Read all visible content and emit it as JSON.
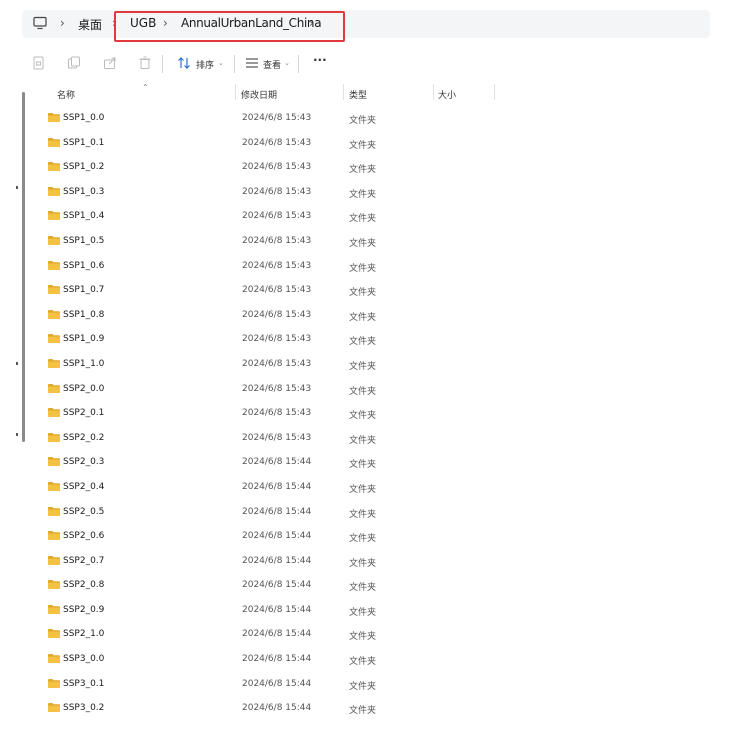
{
  "breadcrumb": {
    "items": [
      "桌面",
      "UGB",
      "AnnualUrbanLand_China"
    ]
  },
  "toolbar": {
    "sort_label": "排序",
    "view_label": "查看",
    "more_label": "···"
  },
  "columns": {
    "name": "名称",
    "modified": "修改日期",
    "type": "类型",
    "size": "大小"
  },
  "files": [
    {
      "name": "SSP1_0.0",
      "modified": "2024/6/8 15:43",
      "type": "文件夹"
    },
    {
      "name": "SSP1_0.1",
      "modified": "2024/6/8 15:43",
      "type": "文件夹"
    },
    {
      "name": "SSP1_0.2",
      "modified": "2024/6/8 15:43",
      "type": "文件夹"
    },
    {
      "name": "SSP1_0.3",
      "modified": "2024/6/8 15:43",
      "type": "文件夹"
    },
    {
      "name": "SSP1_0.4",
      "modified": "2024/6/8 15:43",
      "type": "文件夹"
    },
    {
      "name": "SSP1_0.5",
      "modified": "2024/6/8 15:43",
      "type": "文件夹"
    },
    {
      "name": "SSP1_0.6",
      "modified": "2024/6/8 15:43",
      "type": "文件夹"
    },
    {
      "name": "SSP1_0.7",
      "modified": "2024/6/8 15:43",
      "type": "文件夹"
    },
    {
      "name": "SSP1_0.8",
      "modified": "2024/6/8 15:43",
      "type": "文件夹"
    },
    {
      "name": "SSP1_0.9",
      "modified": "2024/6/8 15:43",
      "type": "文件夹"
    },
    {
      "name": "SSP1_1.0",
      "modified": "2024/6/8 15:43",
      "type": "文件夹"
    },
    {
      "name": "SSP2_0.0",
      "modified": "2024/6/8 15:43",
      "type": "文件夹"
    },
    {
      "name": "SSP2_0.1",
      "modified": "2024/6/8 15:43",
      "type": "文件夹"
    },
    {
      "name": "SSP2_0.2",
      "modified": "2024/6/8 15:43",
      "type": "文件夹"
    },
    {
      "name": "SSP2_0.3",
      "modified": "2024/6/8 15:44",
      "type": "文件夹"
    },
    {
      "name": "SSP2_0.4",
      "modified": "2024/6/8 15:44",
      "type": "文件夹"
    },
    {
      "name": "SSP2_0.5",
      "modified": "2024/6/8 15:44",
      "type": "文件夹"
    },
    {
      "name": "SSP2_0.6",
      "modified": "2024/6/8 15:44",
      "type": "文件夹"
    },
    {
      "name": "SSP2_0.7",
      "modified": "2024/6/8 15:44",
      "type": "文件夹"
    },
    {
      "name": "SSP2_0.8",
      "modified": "2024/6/8 15:44",
      "type": "文件夹"
    },
    {
      "name": "SSP2_0.9",
      "modified": "2024/6/8 15:44",
      "type": "文件夹"
    },
    {
      "name": "SSP2_1.0",
      "modified": "2024/6/8 15:44",
      "type": "文件夹"
    },
    {
      "name": "SSP3_0.0",
      "modified": "2024/6/8 15:44",
      "type": "文件夹"
    },
    {
      "name": "SSP3_0.1",
      "modified": "2024/6/8 15:44",
      "type": "文件夹"
    },
    {
      "name": "SSP3_0.2",
      "modified": "2024/6/8 15:44",
      "type": "文件夹"
    }
  ],
  "colors": {
    "highlight": "#e0393e",
    "folder": "#f4c243",
    "folder_dark": "#e0a82a"
  }
}
